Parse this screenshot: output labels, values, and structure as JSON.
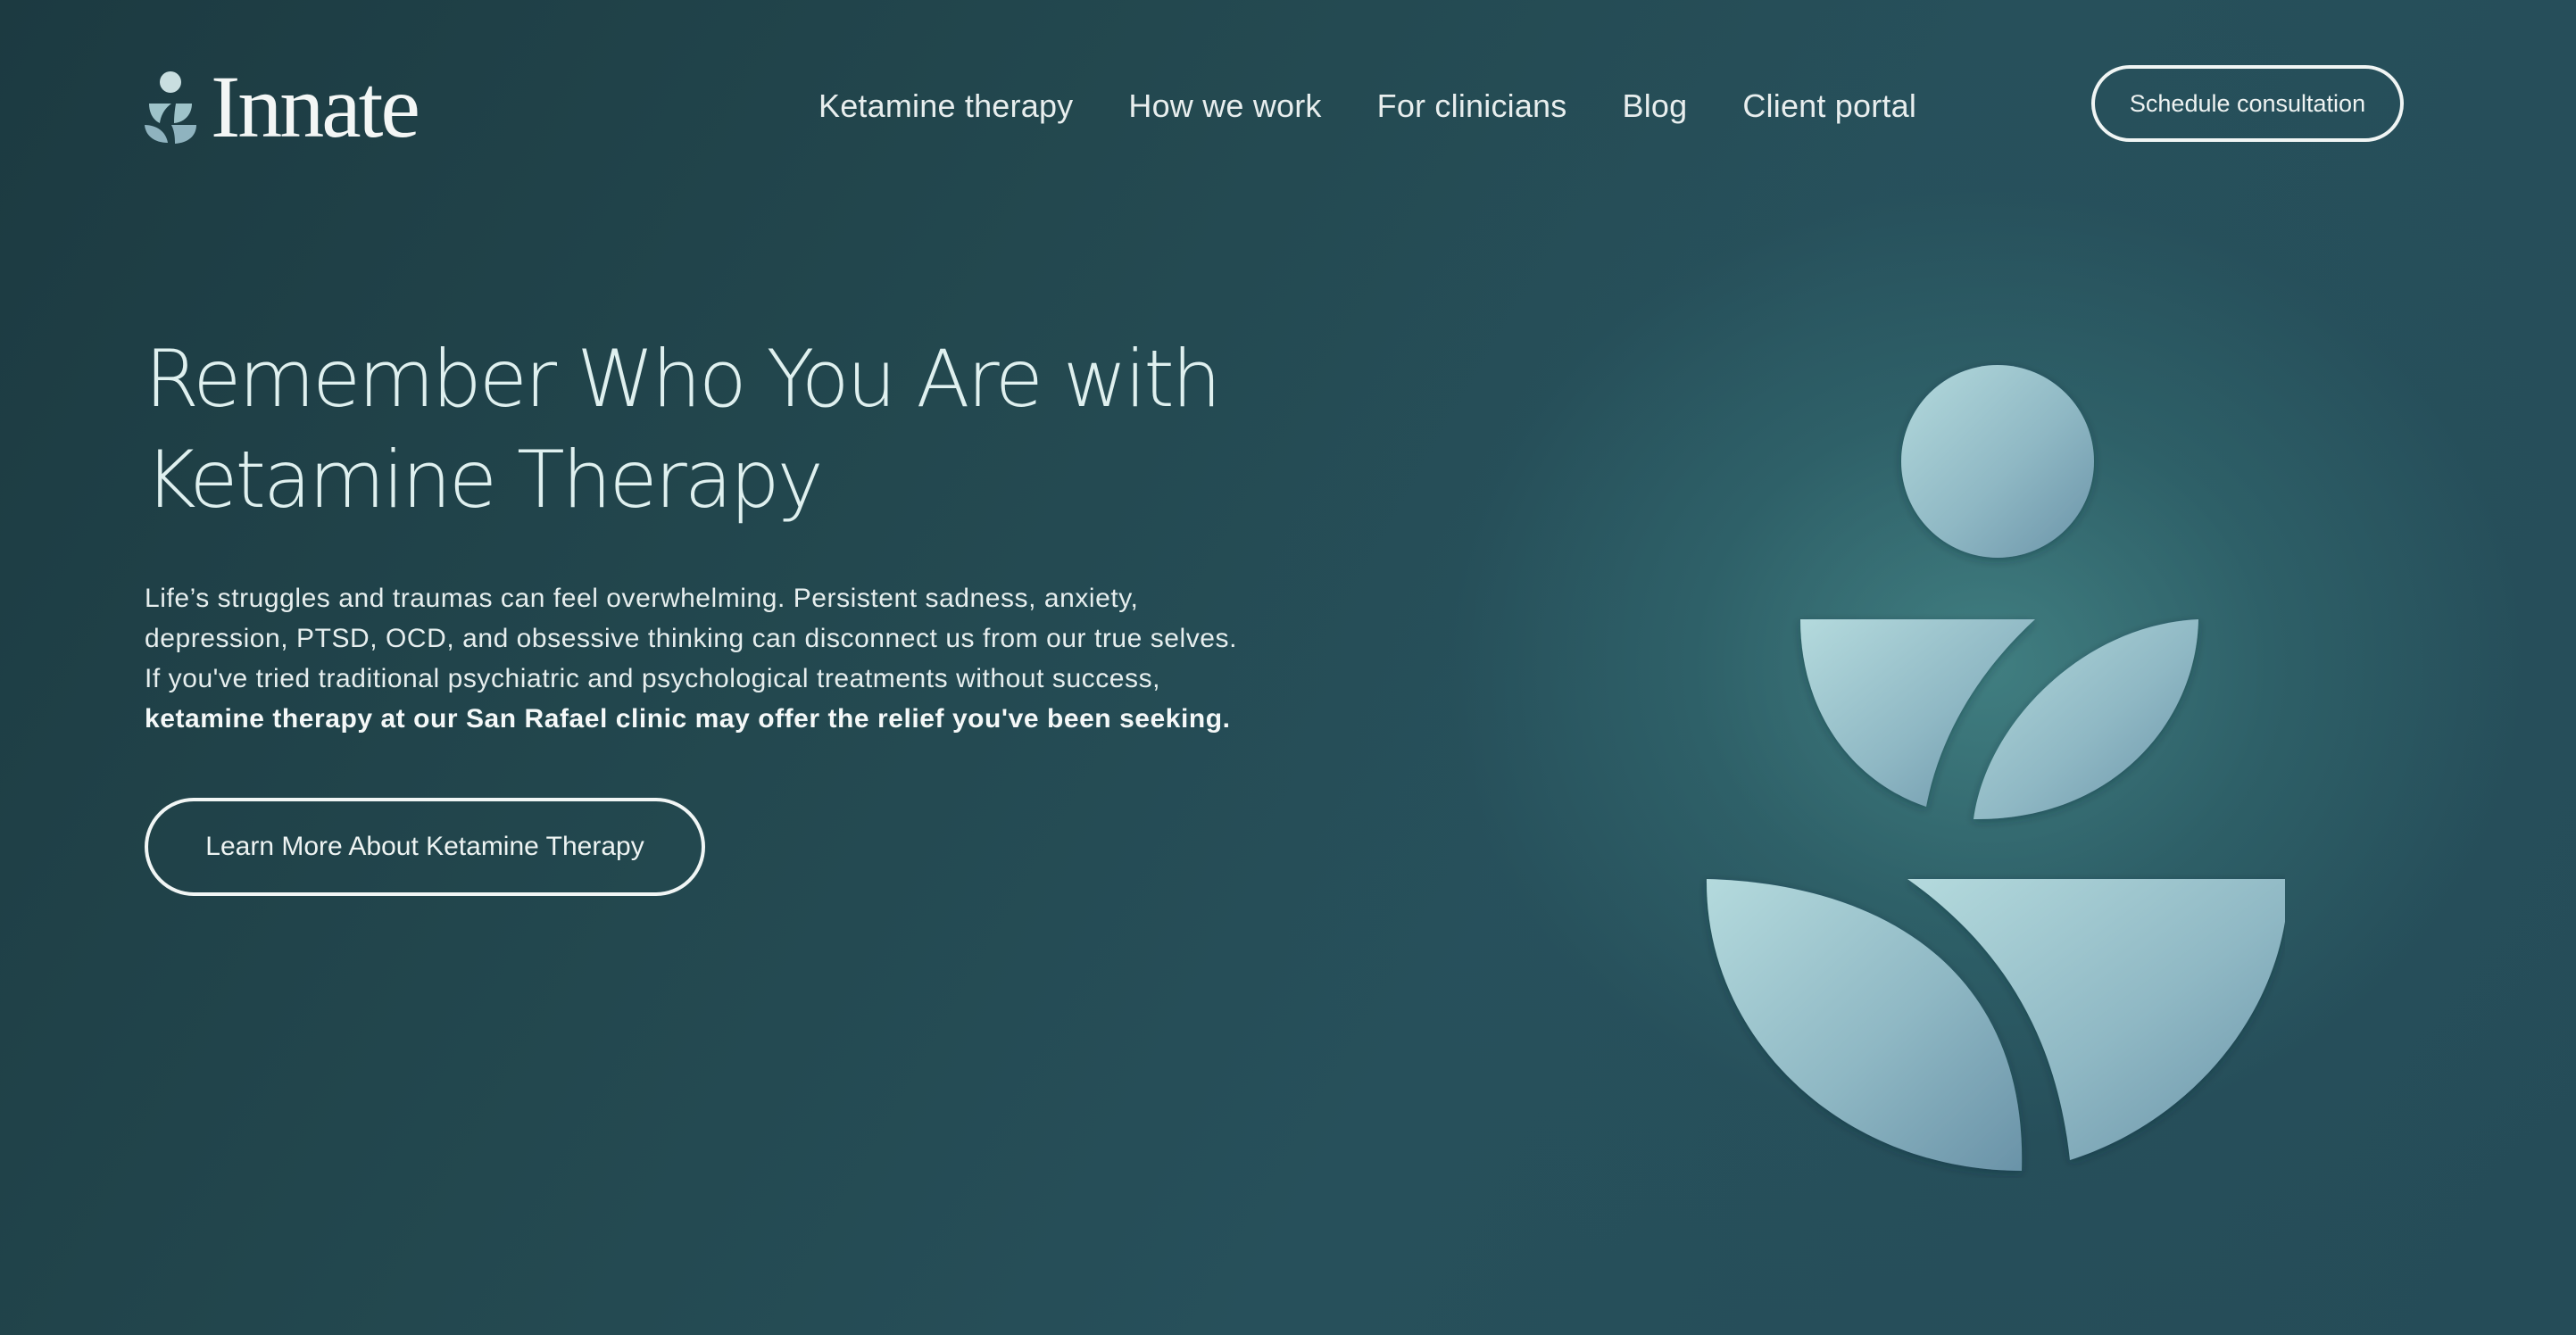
{
  "brand": {
    "name": "Innate",
    "logo_icon": "sprout-person-icon"
  },
  "nav": {
    "items": [
      {
        "label": "Ketamine therapy"
      },
      {
        "label": "How we work"
      },
      {
        "label": "For clinicians"
      },
      {
        "label": "Blog"
      },
      {
        "label": "Client portal"
      }
    ],
    "cta_label": "Schedule consultation"
  },
  "hero": {
    "title_line1": "Remember Who You Are with",
    "title_line2": "Ketamine Therapy",
    "description_lines": [
      "Life’s struggles and traumas can feel overwhelming. Persistent sadness, anxiety,",
      "depression, PTSD, OCD, and obsessive thinking can disconnect us from our true selves.",
      "If you've tried traditional psychiatric and psychological treatments without success,"
    ],
    "description_bold": "ketamine therapy at our San Rafael clinic may offer the relief you've been seeking.",
    "cta_label": "Learn More About Ketamine Therapy",
    "illustration_icon": "abstract-person-leaves-icon"
  },
  "colors": {
    "background": "#23484f",
    "accent_light": "#a9d0d6",
    "accent_mid": "#86adbd",
    "text": "#e9f1f1"
  }
}
